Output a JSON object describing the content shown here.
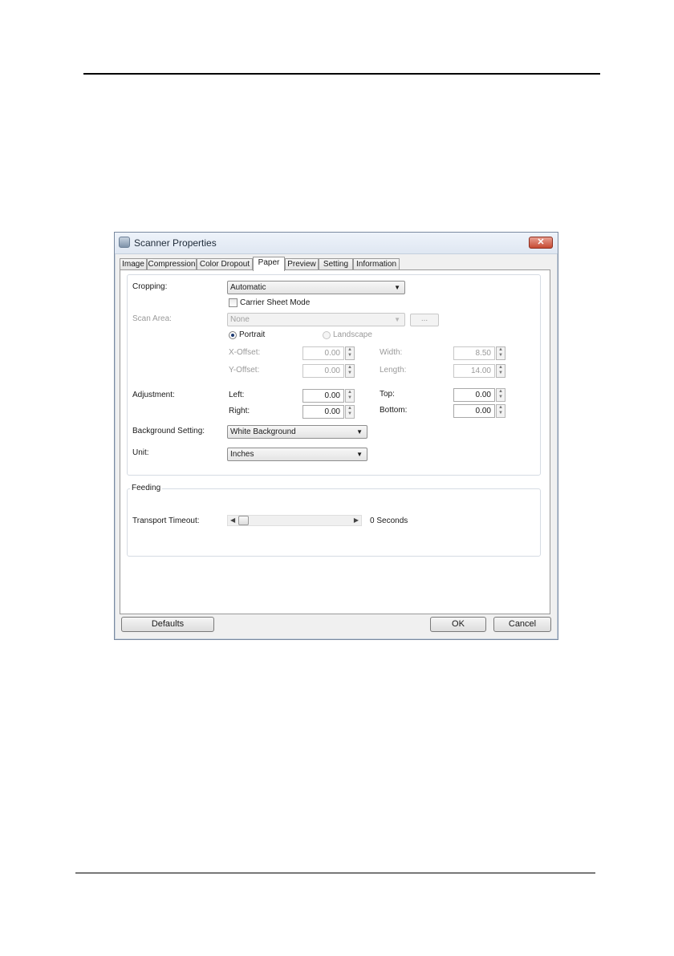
{
  "window": {
    "title": "Scanner Properties",
    "close_symbol": "✕"
  },
  "tabs": [
    {
      "label": "Image"
    },
    {
      "label": "Compression"
    },
    {
      "label": "Color Dropout"
    },
    {
      "label": "Paper"
    },
    {
      "label": "Preview"
    },
    {
      "label": "Setting"
    },
    {
      "label": "Information"
    }
  ],
  "paper": {
    "cropping_label": "Cropping:",
    "cropping_value": "Automatic",
    "carrier_sheet_label": "Carrier Sheet Mode",
    "scan_area_label": "Scan Area:",
    "scan_area_value": "None",
    "browse_label": "...",
    "portrait_label": "Portrait",
    "landscape_label": "Landscape",
    "x_offset_label": "X-Offset:",
    "x_offset_value": "0.00",
    "y_offset_label": "Y-Offset:",
    "y_offset_value": "0.00",
    "width_label": "Width:",
    "width_value": "8.50",
    "length_label": "Length:",
    "length_value": "14.00",
    "adjustment_label": "Adjustment:",
    "left_label": "Left:",
    "left_value": "0.00",
    "right_label": "Right:",
    "right_value": "0.00",
    "top_label": "Top:",
    "top_value": "0.00",
    "bottom_label": "Bottom:",
    "bottom_value": "0.00",
    "background_label": "Background Setting:",
    "background_value": "White Background",
    "unit_label": "Unit:",
    "unit_value": "Inches"
  },
  "feeding": {
    "group_label": "Feeding",
    "timeout_label": "Transport Timeout:",
    "timeout_value": "0 Seconds",
    "timeout_level": 0
  },
  "footer": {
    "defaults_label": "Defaults",
    "ok_label": "OK",
    "cancel_label": "Cancel"
  }
}
